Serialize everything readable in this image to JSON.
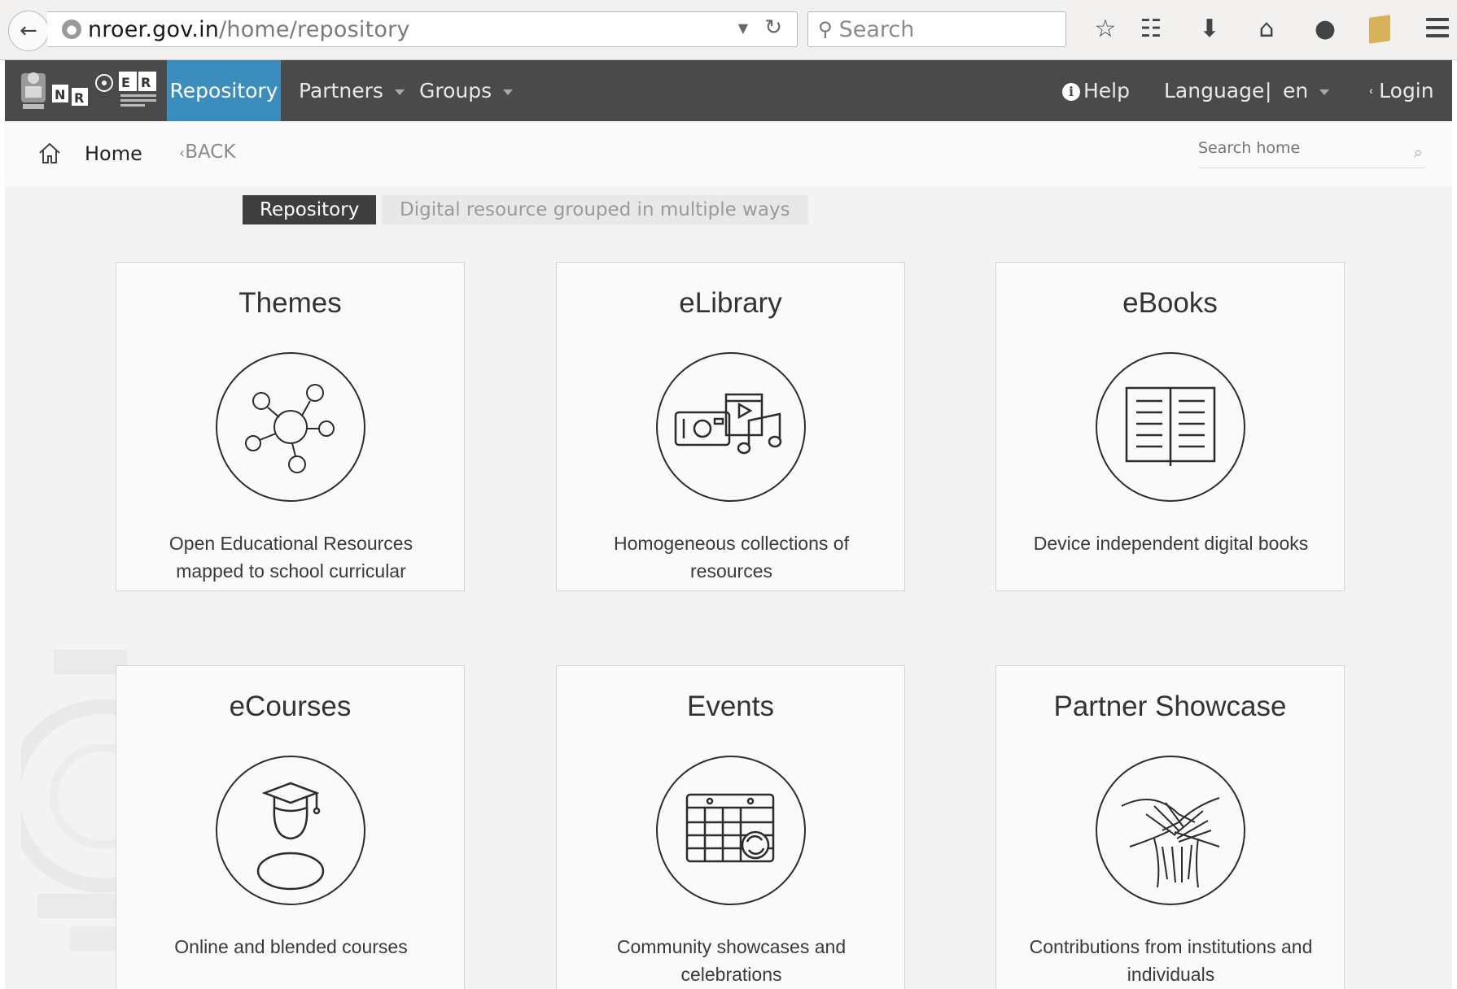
{
  "browser": {
    "url_host": "nroer.gov.in",
    "url_path": "/home/repository",
    "search_placeholder": "Search"
  },
  "nav": {
    "items": [
      {
        "label": "Repository"
      },
      {
        "label": "Partners"
      },
      {
        "label": "Groups"
      }
    ],
    "help_label": "Help",
    "language_label": "Language",
    "divider": "|",
    "language_value": "en",
    "login_label": "Login",
    "logo_text": "NROER"
  },
  "breadcrumb": {
    "home_label": "Home",
    "back_label": "BACK",
    "search_placeholder": "Search home"
  },
  "header": {
    "badge": "Repository",
    "subtitle": "Digital resource grouped in multiple ways"
  },
  "cards": [
    {
      "title": "Themes",
      "desc_line1": "Open Educational Resources",
      "desc_line2": "mapped to school curricular",
      "icon": "network-icon"
    },
    {
      "title": "eLibrary",
      "desc_line1": "Homogeneous collections of",
      "desc_line2": "resources",
      "icon": "media-icon"
    },
    {
      "title": "eBooks",
      "desc_line1": "Device independent digital books",
      "desc_line2": "",
      "icon": "open-book-icon"
    },
    {
      "title": "eCourses",
      "desc_line1": "Online and blended courses",
      "desc_line2": "",
      "icon": "graduate-icon"
    },
    {
      "title": "Events",
      "desc_line1": "Community showcases and",
      "desc_line2": "celebrations",
      "icon": "calendar-icon"
    },
    {
      "title": "Partner Showcase",
      "desc_line1": "Contributions from institutions and",
      "desc_line2": "individuals",
      "icon": "joined-hands-icon"
    }
  ],
  "colors": {
    "nav_bg": "#4a4a4a",
    "nav_active": "#3b8dbd",
    "page_bg": "#f3f3f3",
    "card_bg": "#fafafa"
  }
}
